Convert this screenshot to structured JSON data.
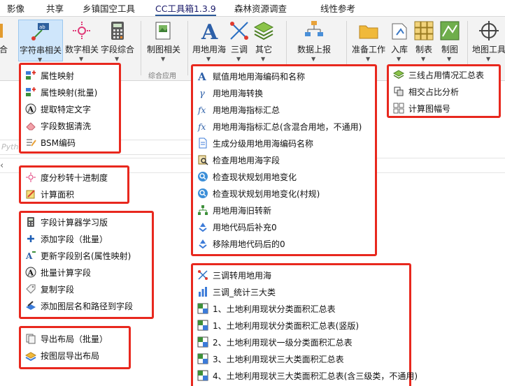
{
  "tabs": [
    "影像",
    "共享",
    "乡镇国空工具",
    "CC工具箱1.3.9",
    "森林资源调查",
    "线性参考"
  ],
  "ribbon": {
    "partial_left": "合",
    "buttons": [
      "字符串相关",
      "数字相关",
      "字段综合",
      "制图相关",
      "用地用海",
      "三调",
      "其它",
      "数据上报",
      "准备工作",
      "入库",
      "制表",
      "制图",
      "地图工具"
    ],
    "group_label": "综合应用"
  },
  "panel": {
    "python_hint": "Pyth"
  },
  "menus": {
    "string_menu": [
      "属性映射",
      "属性映射(批量)",
      "提取特定文字",
      "字段数据清洗",
      "BSM编码"
    ],
    "number_menu": [
      "度分秒转十进制度",
      "计算面积"
    ],
    "field_menu": [
      "字段计算器学习版",
      "添加字段（批量）",
      "更新字段别名(属性映射)",
      "批量计算字段",
      "复制字段",
      "添加图层名和路径到字段"
    ],
    "layout_menu": [
      "导出布局（批量）",
      "按图层导出布局"
    ],
    "landsea_menu": [
      "赋值用地用海编码和名称",
      "用地用海转换",
      "用地用海指标汇总",
      "用地用海指标汇总(含混合用地，不通用)",
      "生成分级用地用海编码名称",
      "检查用地用海字段",
      "检查现状规划用地变化",
      "检查现状规划用地变化(村规)",
      "用地用海旧转新",
      "用地代码后补充0",
      "移除用地代码后的0"
    ],
    "other_menu": [
      "三线占用情况汇总表",
      "相交占比分析",
      "计算图幅号"
    ],
    "sandiao_menu": [
      "三调转用地用海",
      "三调_统计三大类",
      "1、土地利用现状分类面积汇总表",
      "1、土地利用现状分类面积汇总表(竖版)",
      "2、土地利用现状一级分类面积汇总表",
      "3、土地利用现状三大类面积汇总表",
      "4、土地利用现状三大类面积汇总表(含三级类，不通用)"
    ]
  },
  "colors": {
    "menu_border": "#e8281e",
    "highlight": "#cfe6fb",
    "accent": "#2b5797"
  }
}
